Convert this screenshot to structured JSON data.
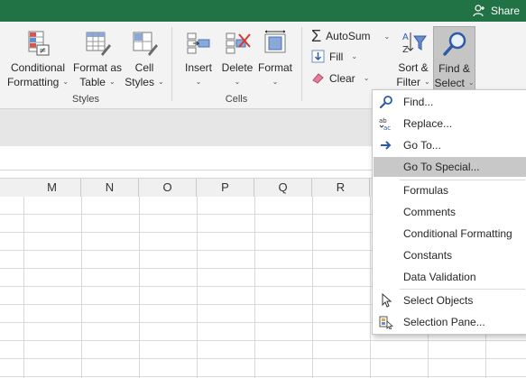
{
  "titlebar": {
    "share_label": "Share",
    "share_icon": "person-icon"
  },
  "ribbon": {
    "styles": {
      "conditional_formatting": [
        "Conditional",
        "Formatting"
      ],
      "format_as_table": [
        "Format as",
        "Table"
      ],
      "cell_styles": [
        "Cell",
        "Styles"
      ],
      "group_label": "Styles"
    },
    "cells": {
      "insert": "Insert",
      "delete": "Delete",
      "format": "Format",
      "group_label": "Cells"
    },
    "editing": {
      "autosum": "AutoSum",
      "fill": "Fill",
      "clear": "Clear",
      "sort_filter": [
        "Sort &",
        "Filter"
      ],
      "find_select": [
        "Find &",
        "Select"
      ]
    }
  },
  "grid": {
    "columns": [
      "M",
      "N",
      "O",
      "P",
      "Q",
      "R"
    ]
  },
  "find_select_menu": {
    "items": [
      {
        "label": "Find...",
        "icon": "search-icon"
      },
      {
        "label": "Replace...",
        "icon": "replace-icon"
      },
      {
        "label": "Go To...",
        "icon": "arrow-right-icon"
      },
      {
        "label": "Go To Special...",
        "icon": "",
        "highlighted": true
      },
      {
        "label": "Formulas",
        "icon": ""
      },
      {
        "label": "Comments",
        "icon": ""
      },
      {
        "label": "Conditional Formatting",
        "icon": ""
      },
      {
        "label": "Constants",
        "icon": ""
      },
      {
        "label": "Data Validation",
        "icon": ""
      },
      {
        "label": "Select Objects",
        "icon": "pointer-icon"
      },
      {
        "label": "Selection Pane...",
        "icon": "selection-pane-icon"
      }
    ]
  },
  "colors": {
    "title_green": "#217346",
    "highlight": "#c8c8c8",
    "ribbon_bg": "#f3f3f3"
  }
}
